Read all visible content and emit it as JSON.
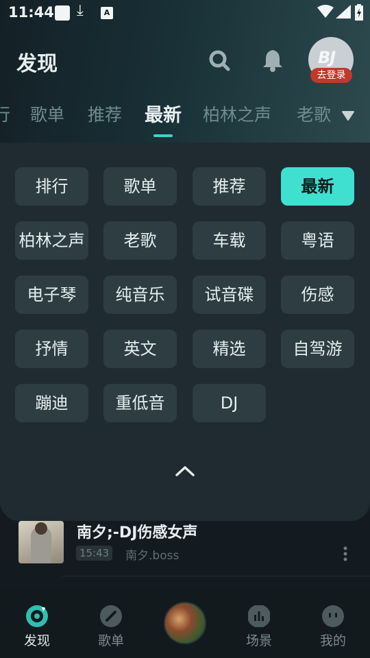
{
  "status_bar": {
    "time": "11:44",
    "icons": [
      "square-icon",
      "download-icon",
      "a-icon",
      "wifi-icon",
      "signal-icon",
      "battery-icon"
    ]
  },
  "header": {
    "title": "发现",
    "search_icon": "search-icon",
    "bell_icon": "bell-icon",
    "avatar_logo": "BJ",
    "login_label": "去登录"
  },
  "tabs": {
    "items": [
      "行",
      "歌单",
      "推荐",
      "最新",
      "柏林之声",
      "老歌"
    ],
    "active": "最新",
    "expand_icon": "triangle-down-icon"
  },
  "category_panel": {
    "chips": [
      "排行",
      "歌单",
      "推荐",
      "最新",
      "柏林之声",
      "老歌",
      "车载",
      "粤语",
      "电子琴",
      "纯音乐",
      "试音碟",
      "伤感",
      "抒情",
      "英文",
      "精选",
      "自驾游",
      "蹦迪",
      "重低音",
      "DJ"
    ],
    "selected": "最新",
    "collapse_icon": "chevron-up-icon"
  },
  "song": {
    "title": "南夕;-DJ伤感女声",
    "duration": "15:43",
    "artist": "南夕.boss",
    "more_icon": "more-vertical-icon"
  },
  "bottom_nav": {
    "items": [
      {
        "label": "发现",
        "icon": "discover-icon"
      },
      {
        "label": "歌单",
        "icon": "playlist-icon"
      },
      {
        "label": "",
        "icon": "now-playing-disc"
      },
      {
        "label": "场景",
        "icon": "scene-icon"
      },
      {
        "label": "我的",
        "icon": "profile-icon"
      }
    ],
    "active": "发现"
  },
  "colors": {
    "accent": "#3fe0d0",
    "background": "#141b20",
    "panel": "#1f2b30",
    "chip": "#2e3d42",
    "login_badge": "#c0392b"
  }
}
